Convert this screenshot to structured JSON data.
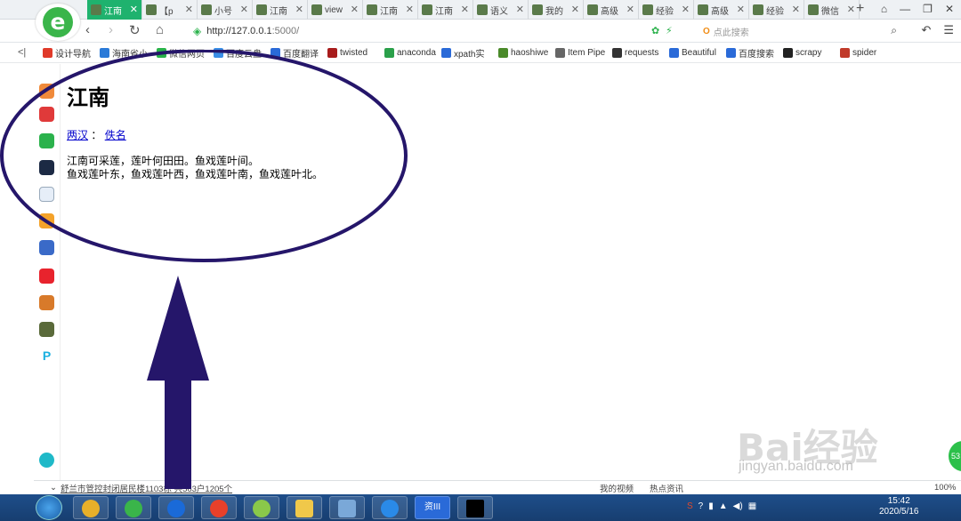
{
  "tabs": [
    {
      "title": "江南",
      "active": true
    },
    {
      "title": "【p"
    },
    {
      "title": "小号"
    },
    {
      "title": "江南"
    },
    {
      "title": "view"
    },
    {
      "title": "江南"
    },
    {
      "title": "江南"
    },
    {
      "title": "语义"
    },
    {
      "title": "我的"
    },
    {
      "title": "高级"
    },
    {
      "title": "经验"
    },
    {
      "title": "高级"
    },
    {
      "title": "经验"
    },
    {
      "title": "微信"
    }
  ],
  "nav": {
    "url_host": "http://127.0.0.1",
    "url_rest": ":5000/",
    "search_placeholder": "点此搜索"
  },
  "bookmarks": [
    {
      "label": "设计导航",
      "color": "#e03a2a"
    },
    {
      "label": "海南省小",
      "color": "#2a7ad8"
    },
    {
      "label": "微信网页",
      "color": "#29b34a"
    },
    {
      "label": "百度云盘",
      "color": "#3a8ee6"
    },
    {
      "label": "百度翻译",
      "color": "#2a6ad8"
    },
    {
      "label": "twisted",
      "color": "#a81c1c"
    },
    {
      "label": "anaconda",
      "color": "#2aa04a"
    },
    {
      "label": "xpath实",
      "color": "#2a6ad8"
    },
    {
      "label": "haoshiwe",
      "color": "#4a8a2a"
    },
    {
      "label": "Item Pipe",
      "color": "#666666"
    },
    {
      "label": "requests",
      "color": "#333333"
    },
    {
      "label": "Beautiful",
      "color": "#2a6ad8"
    },
    {
      "label": "百度搜索",
      "color": "#2a6ad8"
    },
    {
      "label": "scrapy",
      "color": "#222222"
    },
    {
      "label": "spider",
      "color": "#c03a2a"
    }
  ],
  "page": {
    "heading": "江南",
    "link1": "两汉",
    "separator": "：",
    "link2": "佚名",
    "line1": "江南可采莲，莲叶何田田。鱼戏莲叶间。",
    "line2": "鱼戏莲叶东，鱼戏莲叶西，鱼戏莲叶南，鱼戏莲叶北。"
  },
  "status": {
    "news": "舒兰市管控封闭居民楼1103栋 共563户1205个",
    "my_video": "我的视频",
    "hot_news": "热点资讯",
    "zoom": "100%"
  },
  "taskbar": {
    "active_app": "资III",
    "time": "15:42",
    "date": "2020/5/16"
  },
  "watermark": {
    "brand": "Bai经验",
    "domain": "jingyan.baidu.com"
  },
  "colors": {
    "active_tab": "#1fb26e",
    "annotation": "#25166a",
    "link": "#0000cc"
  }
}
